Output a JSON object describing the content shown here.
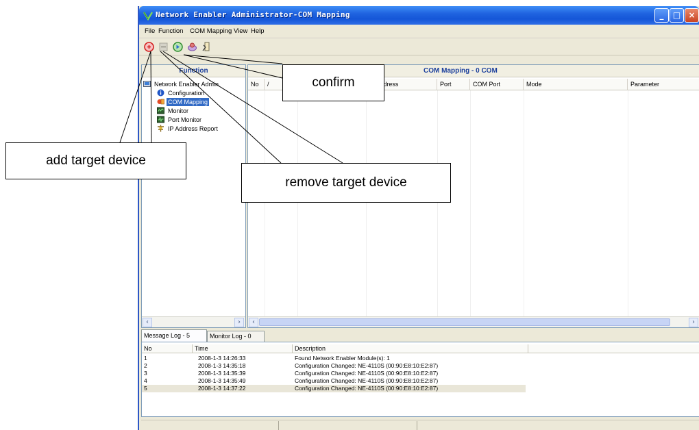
{
  "window": {
    "title": "Network Enabler Administrator-COM Mapping",
    "minimize_glyph": "_",
    "maximize_glyph": "□",
    "close_glyph": "×"
  },
  "menu": [
    "File",
    "Function",
    "COM Mapping",
    "View",
    "Help"
  ],
  "toolbar": {
    "icons": [
      "add-target-icon",
      "remove-target-icon",
      "confirm-icon",
      "settings-icon",
      "exit-icon"
    ]
  },
  "left_panel": {
    "header": "Function",
    "tree": [
      {
        "label": "Network Enabler Admin",
        "icon": "network-icon"
      },
      {
        "label": "Configuration",
        "icon": "info-icon"
      },
      {
        "label": "COM Mapping",
        "icon": "com-mapping-icon",
        "selected": true
      },
      {
        "label": "Monitor",
        "icon": "monitor-icon"
      },
      {
        "label": "Port Monitor",
        "icon": "port-monitor-icon"
      },
      {
        "label": "IP Address Report",
        "icon": "ip-report-icon"
      }
    ]
  },
  "main_panel": {
    "title": "COM Mapping - 0 COM",
    "columns": [
      "No",
      "/",
      "",
      "IP Address",
      "Port",
      "COM Port",
      "Mode",
      "Parameter"
    ]
  },
  "log": {
    "tabs": [
      "Message Log - 5",
      "Monitor Log - 0"
    ],
    "columns": [
      "No",
      "Time",
      "Description"
    ],
    "rows": [
      {
        "no": "1",
        "time": "2008-1-3 14:26:33",
        "desc": "Found Network Enabler Module(s): 1"
      },
      {
        "no": "2",
        "time": "2008-1-3 14:35:18",
        "desc": "Configuration Changed: NE-4110S (00:90:E8:10:E2:87)"
      },
      {
        "no": "3",
        "time": "2008-1-3 14:35:39",
        "desc": "Configuration Changed: NE-4110S (00:90:E8:10:E2:87)"
      },
      {
        "no": "4",
        "time": "2008-1-3 14:35:49",
        "desc": "Configuration Changed: NE-4110S (00:90:E8:10:E2:87)"
      },
      {
        "no": "5",
        "time": "2008-1-3 14:37:22",
        "desc": "Configuration Changed: NE-4110S (00:90:E8:10:E2:87)",
        "highlighted": true
      }
    ]
  },
  "callouts": {
    "confirm": "confirm",
    "add": "add target device",
    "remove": "remove target device"
  },
  "colors": {
    "title_bar": "#1f63e0",
    "panel_header_text": "#1b3f9c",
    "selection": "#316ac5",
    "window_face": "#ece9d8"
  }
}
